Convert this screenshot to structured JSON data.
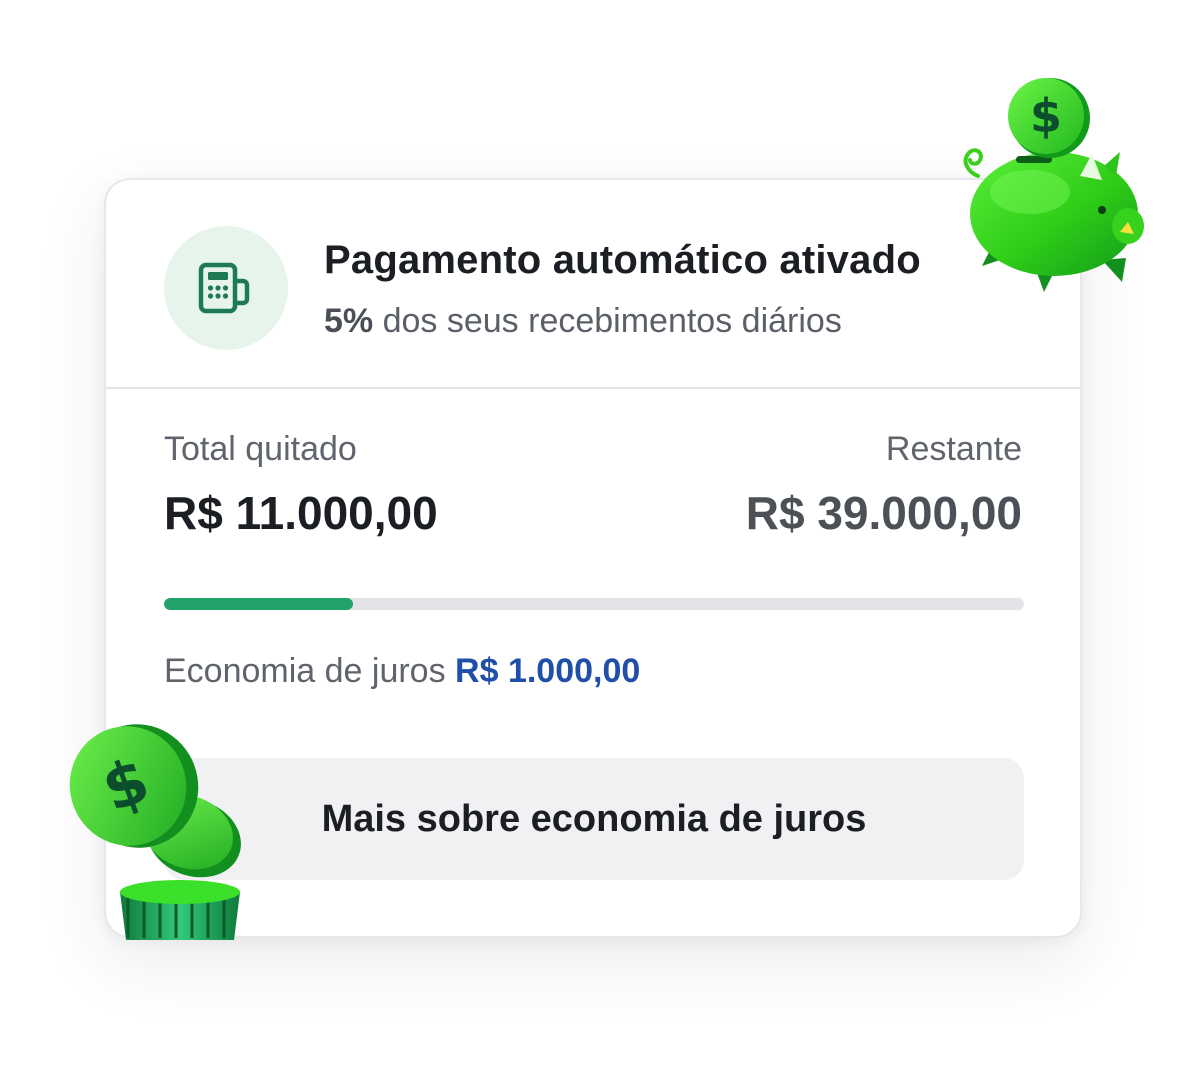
{
  "header": {
    "icon": "card-machine-icon",
    "title": "Pagamento automático ativado",
    "subtitle_percent": "5%",
    "subtitle_rest": " dos seus recebimentos diários"
  },
  "summary": {
    "paid_label": "Total quitado",
    "paid_value": "R$ 11.000,00",
    "remaining_label": "Restante",
    "remaining_value": "R$ 39.000,00",
    "progress_fraction": 0.22
  },
  "savings": {
    "label": "Economia de juros ",
    "value": "R$ 1.000,00"
  },
  "more_button": {
    "label": "Mais sobre economia de juros"
  },
  "decorations": {
    "piggy": "piggy-bank-coin-icon",
    "coins": "coin-stack-icon"
  },
  "colors": {
    "accent_green": "#21a36a",
    "link_blue": "#1f4fa8",
    "illustration_green": "#3ad01c"
  }
}
